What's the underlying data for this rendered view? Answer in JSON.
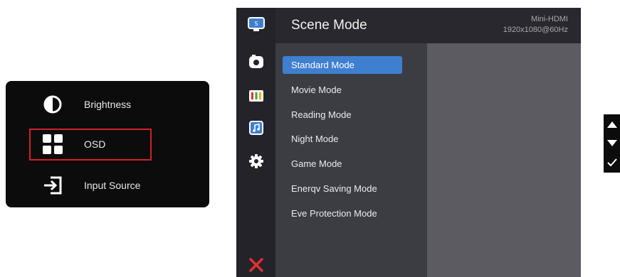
{
  "quick_menu": {
    "items": [
      {
        "label": "Brightness",
        "icon": "brightness-icon"
      },
      {
        "label": "OSD",
        "icon": "osd-grid-icon",
        "highlighted": true
      },
      {
        "label": "Input Source",
        "icon": "input-source-icon"
      }
    ],
    "highlight_color": "#d32026"
  },
  "osd": {
    "title": "Scene Mode",
    "signal": {
      "input": "Mini-HDMI",
      "resolution": "1920x1080@60Hz"
    },
    "sidebar_icons": [
      "scene-mode-icon",
      "picture-icon",
      "color-icon",
      "audio-icon",
      "settings-icon",
      "exit-icon"
    ],
    "modes": [
      "Standard Mode",
      "Movie Mode",
      "Reading Mode",
      "Night Mode",
      "Game Mode",
      "Enerqv Saving Mode",
      "Eve Protection Mode"
    ],
    "selected_mode": "Standard Mode",
    "accent_color": "#3f7fd0",
    "exit_color": "#e0312f"
  },
  "key_hints": [
    "up-arrow-icon",
    "down-arrow-icon",
    "check-icon"
  ]
}
